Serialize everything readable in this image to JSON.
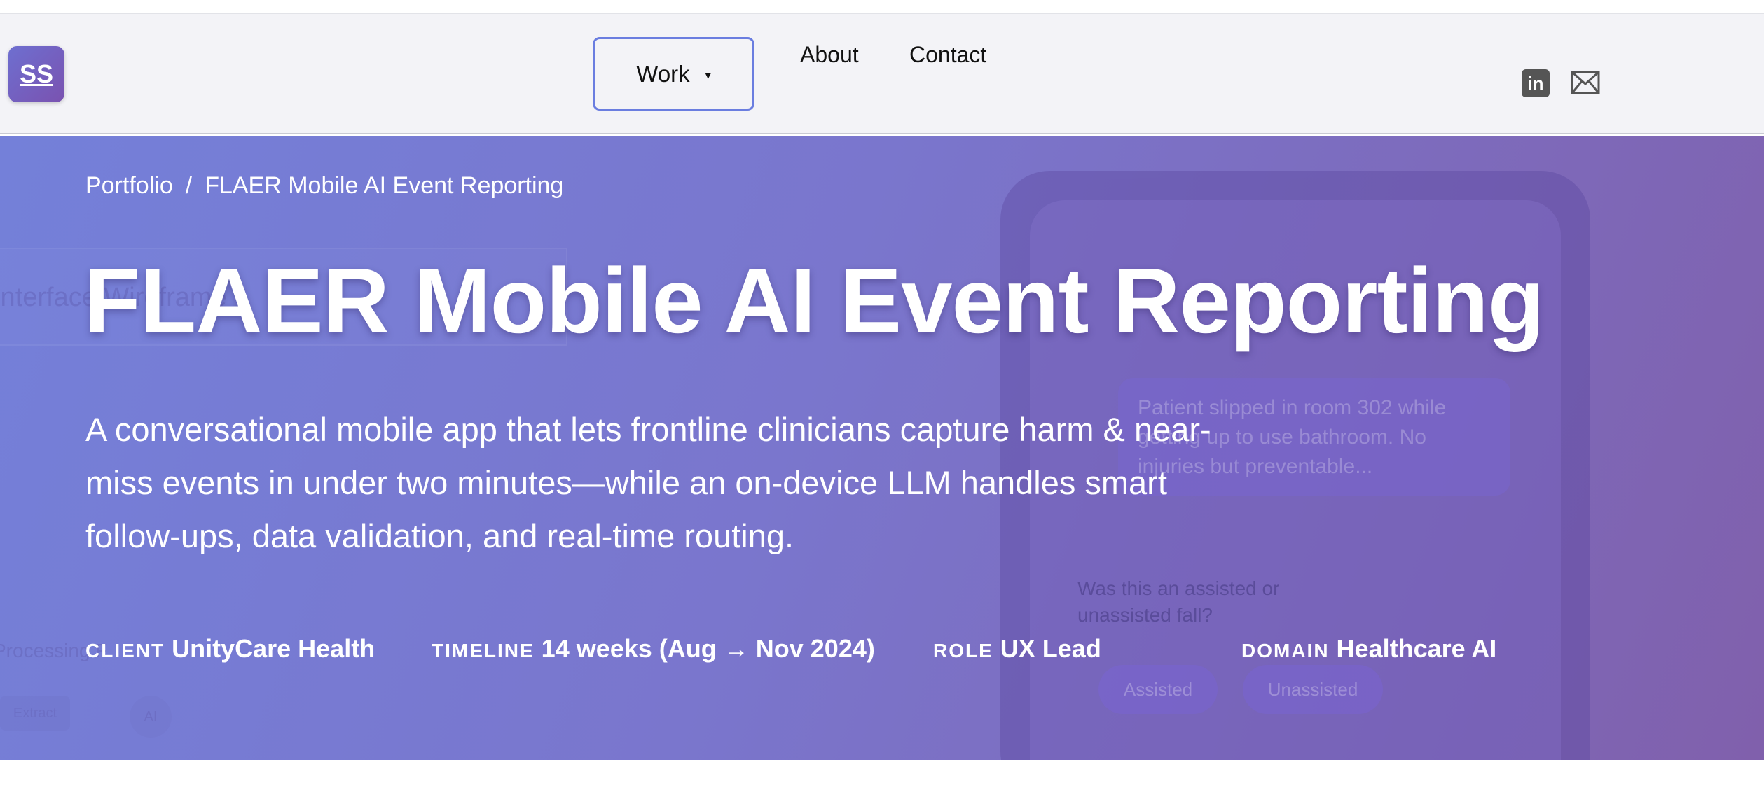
{
  "logo": {
    "text": "SS"
  },
  "nav": {
    "work_label": "Work",
    "work_caret": "▾",
    "about_label": "About",
    "contact_label": "Contact"
  },
  "social": {
    "linkedin_text": "in"
  },
  "hero": {
    "breadcrumb": {
      "root": "Portfolio",
      "separator": "/",
      "current": "FLAER Mobile AI Event Reporting"
    },
    "title": "FLAER Mobile AI Event Reporting",
    "subtitle": "A conversational mobile app that lets frontline clinicians capture harm & near-miss events in under two minutes—while an on-device LLM handles smart follow-ups, data validation, and real-time routing.",
    "meta": [
      {
        "key": "CLIENT",
        "value": "UnityCare Health"
      },
      {
        "key": "TIMELINE",
        "value": "14 weeks (Aug → Nov 2024)"
      },
      {
        "key": "ROLE",
        "value": "UX Lead"
      },
      {
        "key": "DOMAIN",
        "value": "Healthcare AI"
      }
    ]
  },
  "background_decor": {
    "wire_title": "Interface Wireframe",
    "wire_processing": "Processing F",
    "wire_extract": "Extract",
    "wire_ai": "AI",
    "phone_message": "Patient slipped in room 302 while getting up to use bathroom. No injuries but preventable...",
    "phone_question": "Was this an assisted or unassisted fall?",
    "phone_option_1": "Assisted",
    "phone_option_2": "Unassisted"
  },
  "colors": {
    "hero_gradient_start": "#7480d9",
    "hero_gradient_end": "#8060ac",
    "nav_bg": "#f3f3f7",
    "work_border": "#6a7de0"
  }
}
